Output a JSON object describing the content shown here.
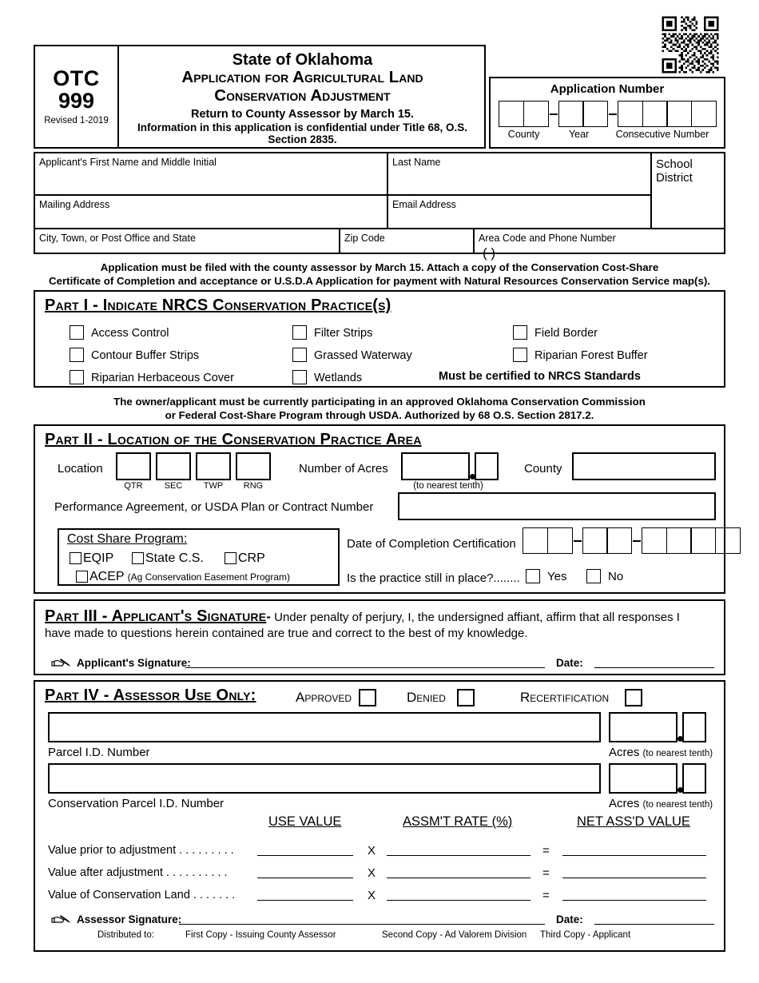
{
  "form": {
    "agency_code": "OTC",
    "form_number": "999",
    "revised": "Revised 1-2019",
    "title_line1": "State of Oklahoma",
    "title_line2": "Application for Agricultural Land",
    "title_line3": "Conservation Adjustment",
    "return_line": "Return to County Assessor by March 15.",
    "confidential_line": "Information in this application is confidential under Title 68, O.S. Section 2835.",
    "qr_icon": "qr-code-icon"
  },
  "application_number": {
    "title": "Application Number",
    "groups": [
      {
        "label": "County",
        "cells": 2
      },
      {
        "label": "Year",
        "cells": 2
      },
      {
        "label": "Consecutive Number",
        "cells": 4
      }
    ]
  },
  "applicant": {
    "first_name_label": "Applicant's First Name and Middle Initial",
    "last_name_label": "Last Name",
    "school_district_label_line1": "School",
    "school_district_label_line2": "District",
    "mailing_address_label": "Mailing Address",
    "email_label": "Email Address",
    "city_label": "City, Town, or Post Office and State",
    "zip_label": "Zip Code",
    "phone_label": "Area Code and Phone Number",
    "phone_parens": "(                )"
  },
  "notice": {
    "line1": "Application must be filed with the county assessor by March 15.  Attach a copy of the Conservation Cost-Share",
    "line2": "Certificate of Completion and acceptance or U.S.D.A Application for payment with Natural Resources Conservation Service map(s)."
  },
  "part1": {
    "title": "Part I - Indicate NRCS Conservation Practice(s)",
    "col1": [
      "Access Control",
      "Contour Buffer Strips",
      "Riparian Herbaceous Cover"
    ],
    "col2": [
      "Filter Strips",
      "Grassed Waterway",
      "Wetlands"
    ],
    "col3": [
      "Field Border",
      "Riparian Forest Buffer"
    ],
    "certified_note": "Must be certified to NRCS Standards"
  },
  "notice2": {
    "line1": "The owner/applicant must be currently participating in an approved Oklahoma Conservation Commission",
    "line2": "or Federal Cost-Share Program through USDA.  Authorized by 68 O.S. Section 2817.2."
  },
  "part2": {
    "title": "Part II - Location of the Conservation Practice Area",
    "location_label": "Location",
    "location_sublabels": [
      "QTR",
      "SEC",
      "TWP",
      "RNG"
    ],
    "acres_label": "Number of Acres",
    "acres_note": "(to nearest tenth)",
    "county_label": "County",
    "performance_label": "Performance Agreement, or USDA Plan or Contract Number",
    "cost_share_title": "Cost Share Program:",
    "cost_share_row1": [
      "EQIP",
      "State C.S.",
      "CRP"
    ],
    "cost_share_acep": "ACEP",
    "cost_share_acep_note": "(Ag Conservation Easement Program)",
    "date_label": "Date of Completion Certification",
    "date_groups": [
      2,
      2,
      4
    ],
    "in_place_label": "Is the practice still in place?........",
    "yes_label": "Yes",
    "no_label": "No"
  },
  "part3": {
    "title": "Part III - Applicant's Signature",
    "dash": "-",
    "body_line1": "Under penalty of perjury, I, the undersigned affiant, affirm that all responses I",
    "body_line2": "have made to questions herein contained are true and correct to the best of my knowledge.",
    "signature_label": "Applicant's Signature:",
    "date_label": "Date:",
    "signature_icon": "hand-with-pen-icon"
  },
  "part4": {
    "title": "Part IV - Assessor Use Only:",
    "approved_label": "Approved",
    "denied_label": "Denied",
    "recertification_label": "Recertification",
    "parcel_label": "Parcel I.D. Number",
    "conservation_parcel_label": "Conservation Parcel I.D. Number",
    "acres_label": "Acres",
    "acres_note": "(to nearest tenth)",
    "columns": [
      "USE VALUE",
      "ASSM'T RATE (%)",
      "NET ASS'D VALUE"
    ],
    "operators": {
      "multiply": "X",
      "equals": "="
    },
    "rows": [
      "Value prior to adjustment . . . . . . . . .",
      "Value after adjustment  . . . . . . . . . .",
      "Value of Conservation Land . . . . . . ."
    ],
    "assessor_signature_label": "Assessor Signature:",
    "assessor_date_label": "Date:",
    "signature_icon": "hand-with-pen-icon",
    "distributed_label": "Distributed to:",
    "copies": [
      "First Copy - Issuing County Assessor",
      "Second Copy - Ad Valorem Division",
      "Third Copy - Applicant"
    ]
  }
}
